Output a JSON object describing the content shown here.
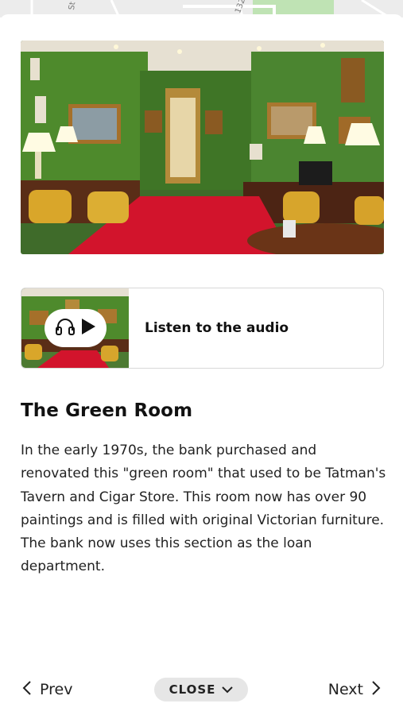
{
  "map": {
    "labels": [
      "St",
      "132"
    ]
  },
  "hero": {
    "image": "green-room-photo"
  },
  "audio": {
    "label": "Listen to the audio",
    "icons": [
      "headphones-icon",
      "play-icon"
    ]
  },
  "stop": {
    "title": "The Green Room",
    "description": "In the early 1970s, the bank purchased and renovated this \"green room\" that used to be Tatman's Tavern and Cigar Store. This room now has over 90 paintings and is filled with original Victorian furniture. The bank now uses this section as the loan department."
  },
  "nav": {
    "prev_label": "Prev",
    "close_label": "CLOSE",
    "next_label": "Next"
  },
  "colors": {
    "wall_green": "#4f8a2e",
    "carpet_red": "#c8102e",
    "close_bg": "#e6e6e6"
  }
}
